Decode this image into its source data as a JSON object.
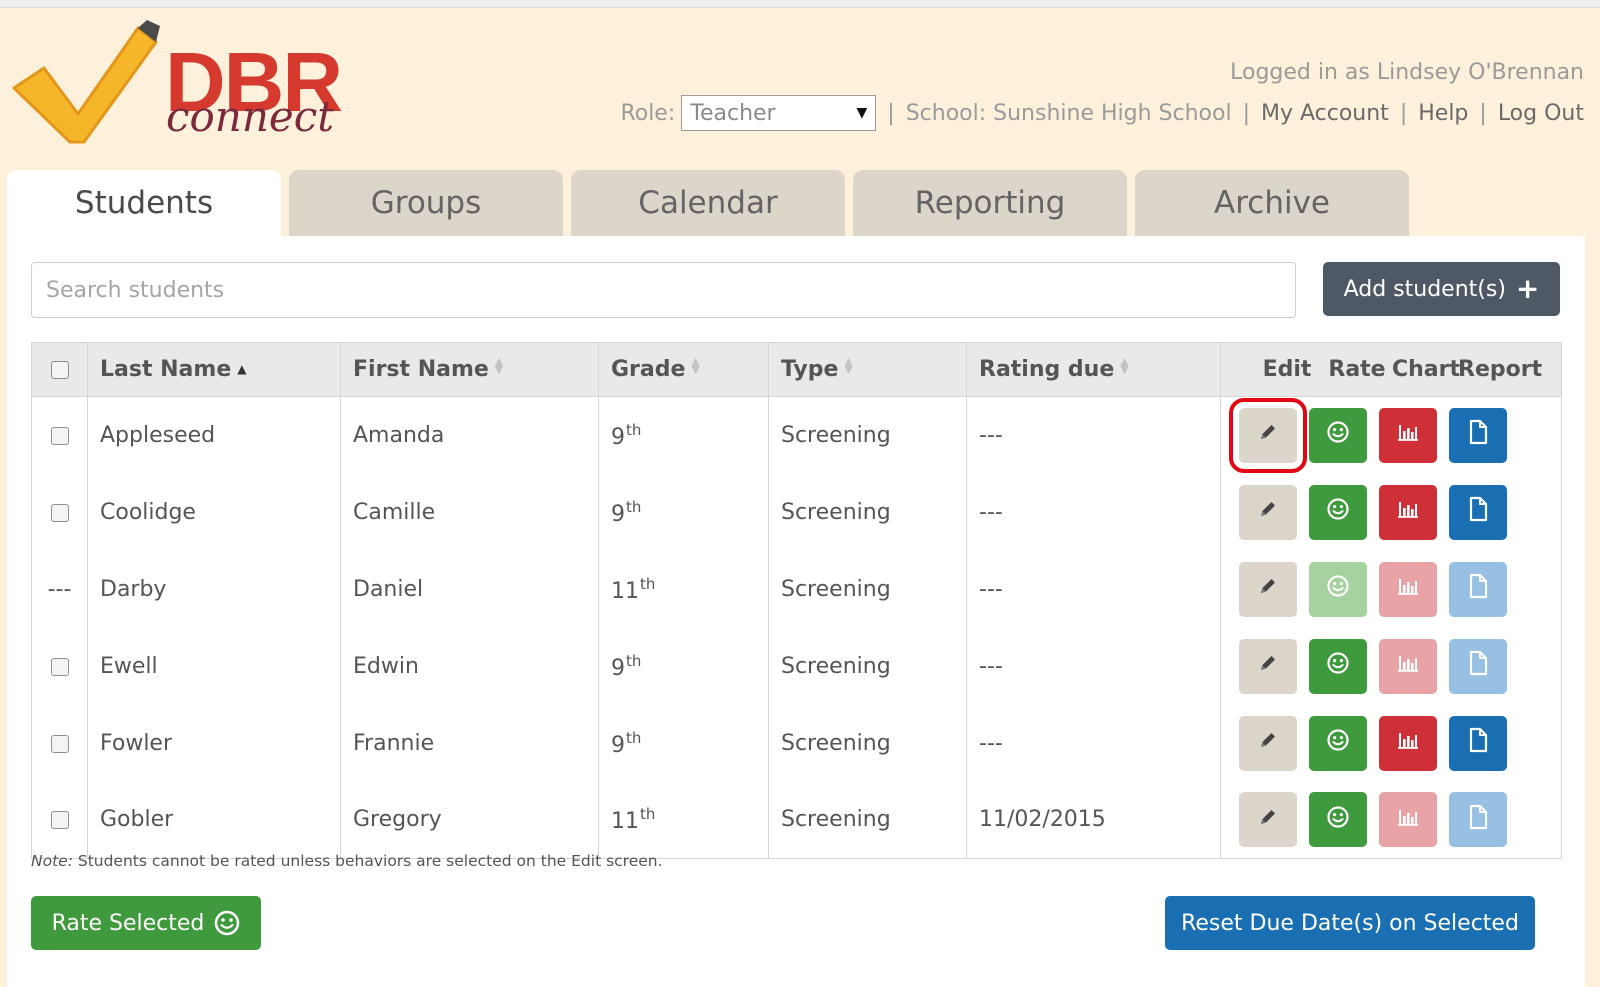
{
  "brand": {
    "name": "DBR",
    "subtitle": "connect"
  },
  "header": {
    "logged_in_text": "Logged in as Lindsey O'Brennan",
    "role_label": "Role:",
    "role_value": "Teacher",
    "school_text": "School: Sunshine High School",
    "my_account": "My Account",
    "help": "Help",
    "logout": "Log Out",
    "separator": "|"
  },
  "tabs": [
    {
      "label": "Students",
      "active": true
    },
    {
      "label": "Groups",
      "active": false
    },
    {
      "label": "Calendar",
      "active": false
    },
    {
      "label": "Reporting",
      "active": false
    },
    {
      "label": "Archive",
      "active": false
    }
  ],
  "search": {
    "placeholder": "Search students",
    "value": ""
  },
  "add_button": {
    "label": "Add student(s)",
    "icon": "plus-icon"
  },
  "table": {
    "columns": {
      "last_name": "Last Name",
      "first_name": "First Name",
      "grade": "Grade",
      "type": "Type",
      "rating_due": "Rating due",
      "edit": "Edit",
      "rate": "Rate",
      "chart": "Chart",
      "report": "Report"
    },
    "rows": [
      {
        "select": "checkbox",
        "last": "Appleseed",
        "first": "Amanda",
        "grade": "9",
        "grade_suffix": "th",
        "type": "Screening",
        "due": "---"
      },
      {
        "select": "checkbox",
        "last": "Coolidge",
        "first": "Camille",
        "grade": "9",
        "grade_suffix": "th",
        "type": "Screening",
        "due": "---"
      },
      {
        "select": "---",
        "last": "Darby",
        "first": "Daniel",
        "grade": "11",
        "grade_suffix": "th",
        "type": "Screening",
        "due": "---"
      },
      {
        "select": "checkbox",
        "last": "Ewell",
        "first": "Edwin",
        "grade": "9",
        "grade_suffix": "th",
        "type": "Screening",
        "due": "---"
      },
      {
        "select": "checkbox",
        "last": "Fowler",
        "first": "Frannie",
        "grade": "9",
        "grade_suffix": "th",
        "type": "Screening",
        "due": "---"
      },
      {
        "select": "checkbox",
        "last": "Gobler",
        "first": "Gregory",
        "grade": "11",
        "grade_suffix": "th",
        "type": "Screening",
        "due": "11/02/2015"
      }
    ]
  },
  "note": {
    "label": "Note:",
    "text": " Students cannot be rated unless behaviors are selected on the Edit screen."
  },
  "rate_selected": {
    "label": "Rate Selected",
    "icon": "smiley-icon"
  },
  "reset_due": {
    "label": "Reset Due Date(s) on Selected"
  },
  "colors": {
    "background": "#fdf1dc",
    "brand_red": "#d63a2f",
    "edit": "#dcd5c9",
    "rate": "#3f9a3d",
    "chart": "#cf2f36",
    "report": "#1a6fb3",
    "highlight": "#e30613",
    "due_overdue": "#c0392b"
  },
  "row_button_state": [
    {
      "rate": "enabled",
      "chart": "enabled",
      "report": "enabled"
    },
    {
      "rate": "enabled",
      "chart": "enabled",
      "report": "enabled"
    },
    {
      "rate": "disabled",
      "chart": "disabled",
      "report": "disabled"
    },
    {
      "rate": "enabled",
      "chart": "disabled",
      "report": "disabled"
    },
    {
      "rate": "enabled",
      "chart": "enabled",
      "report": "enabled"
    },
    {
      "rate": "enabled",
      "chart": "disabled",
      "report": "disabled"
    }
  ],
  "highlighted_button": "edit-button-row-1"
}
